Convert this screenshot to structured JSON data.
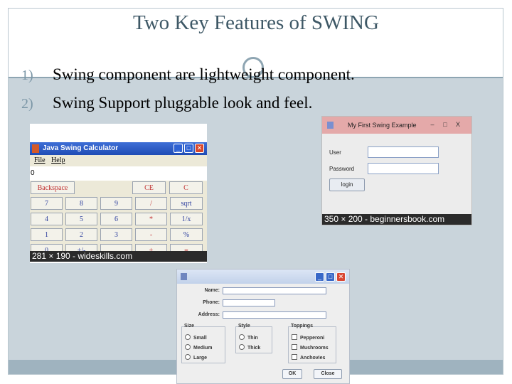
{
  "slide": {
    "title": "Two Key Features of SWING",
    "bullets": [
      {
        "num": "1)",
        "text": "Swing component are lightweight component."
      },
      {
        "num": "2)",
        "text": "Swing Support pluggable look and feel."
      }
    ]
  },
  "calculator": {
    "window_title": "Java Swing Calculator",
    "menu": [
      "File",
      "Help"
    ],
    "display_value": "0",
    "rows": [
      [
        "Backspace",
        "CE",
        "C"
      ],
      [
        "7",
        "8",
        "9",
        "/",
        "sqrt"
      ],
      [
        "4",
        "5",
        "6",
        "*",
        "1/x"
      ],
      [
        "1",
        "2",
        "3",
        "-",
        "%"
      ],
      [
        "0",
        "+/-",
        ".",
        "+",
        "="
      ]
    ],
    "caption": "281 × 190 - wideskills.com"
  },
  "first_example": {
    "window_title": "My First Swing Example",
    "user_label": "User",
    "password_label": "Password",
    "login_button": "login",
    "caption": "350 × 200 - beginnersbook.com",
    "controls": {
      "minimize": "–",
      "maximize": "□",
      "close": "X"
    }
  },
  "form": {
    "name_label": "Name:",
    "phone_label": "Phone:",
    "address_label": "Address:",
    "size": {
      "title": "Size",
      "options": [
        "Small",
        "Medium",
        "Large"
      ]
    },
    "style": {
      "title": "Style",
      "options": [
        "Thin",
        "Thick"
      ]
    },
    "toppings": {
      "title": "Toppings",
      "options": [
        "Pepperoni",
        "Mushrooms",
        "Anchovies"
      ]
    },
    "ok_button": "OK",
    "close_button": "Close"
  },
  "colors": {
    "title_text": "#3e5866",
    "body_band": "#c9d4db",
    "number_color": "#7b96a6"
  }
}
